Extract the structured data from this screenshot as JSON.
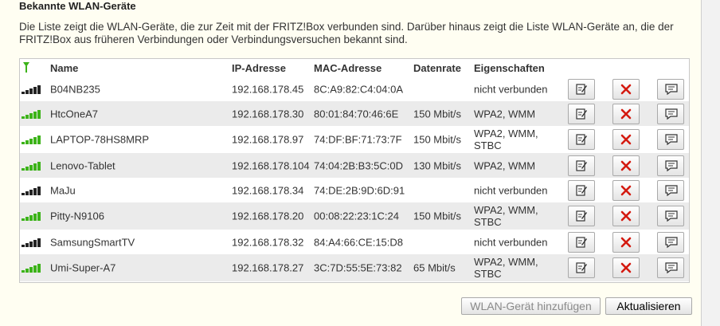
{
  "heading": "Bekannte WLAN-Geräte",
  "intro": "Die Liste zeigt die WLAN-Geräte, die zur Zeit mit der FRITZ!Box verbunden sind. Darüber hinaus zeigt die Liste WLAN-Geräte an, die der FRITZ!Box aus früheren Verbindungen oder Verbindungsversuchen bekannt sind.",
  "columns": {
    "name": "Name",
    "ip": "IP-Adresse",
    "mac": "MAC-Adresse",
    "rate": "Datenrate",
    "props": "Eigenschaften"
  },
  "colors": {
    "signal_active": "#3cb319",
    "signal_inactive": "#222222",
    "delete": "#d41a10"
  },
  "icons": {
    "antenna": "antenna-icon",
    "signal": "signal-strength-icon",
    "edit": "edit-icon",
    "delete": "delete-icon",
    "details": "details-icon"
  },
  "devices": [
    {
      "name": "B04NB235",
      "ip": "192.168.178.45",
      "mac": "8C:A9:82:C4:04:0A",
      "rate": "",
      "props": "nicht verbunden",
      "connected": false
    },
    {
      "name": "HtcOneA7",
      "ip": "192.168.178.30",
      "mac": "80:01:84:70:46:6E",
      "rate": "150 Mbit/s",
      "props": "WPA2, WMM",
      "connected": true
    },
    {
      "name": "LAPTOP-78HS8MRP",
      "ip": "192.168.178.97",
      "mac": "74:DF:BF:71:73:7F",
      "rate": "150 Mbit/s",
      "props": "WPA2, WMM, STBC",
      "connected": true
    },
    {
      "name": "Lenovo-Tablet",
      "ip": "192.168.178.104",
      "mac": "74:04:2B:B3:5C:0D",
      "rate": "130 Mbit/s",
      "props": "WPA2, WMM",
      "connected": true
    },
    {
      "name": "MaJu",
      "ip": "192.168.178.34",
      "mac": "74:DE:2B:9D:6D:91",
      "rate": "",
      "props": "nicht verbunden",
      "connected": false
    },
    {
      "name": "Pitty-N9106",
      "ip": "192.168.178.20",
      "mac": "00:08:22:23:1C:24",
      "rate": "150 Mbit/s",
      "props": "WPA2, WMM, STBC",
      "connected": true
    },
    {
      "name": "SamsungSmartTV",
      "ip": "192.168.178.32",
      "mac": "84:A4:66:CE:15:D8",
      "rate": "",
      "props": "nicht verbunden",
      "connected": false
    },
    {
      "name": "Umi-Super-A7",
      "ip": "192.168.178.27",
      "mac": "3C:7D:55:5E:73:82",
      "rate": "65 Mbit/s",
      "props": "WPA2, WMM, STBC",
      "connected": true
    }
  ],
  "buttons": {
    "add": "WLAN-Gerät hinzufügen",
    "refresh": "Aktualisieren"
  }
}
